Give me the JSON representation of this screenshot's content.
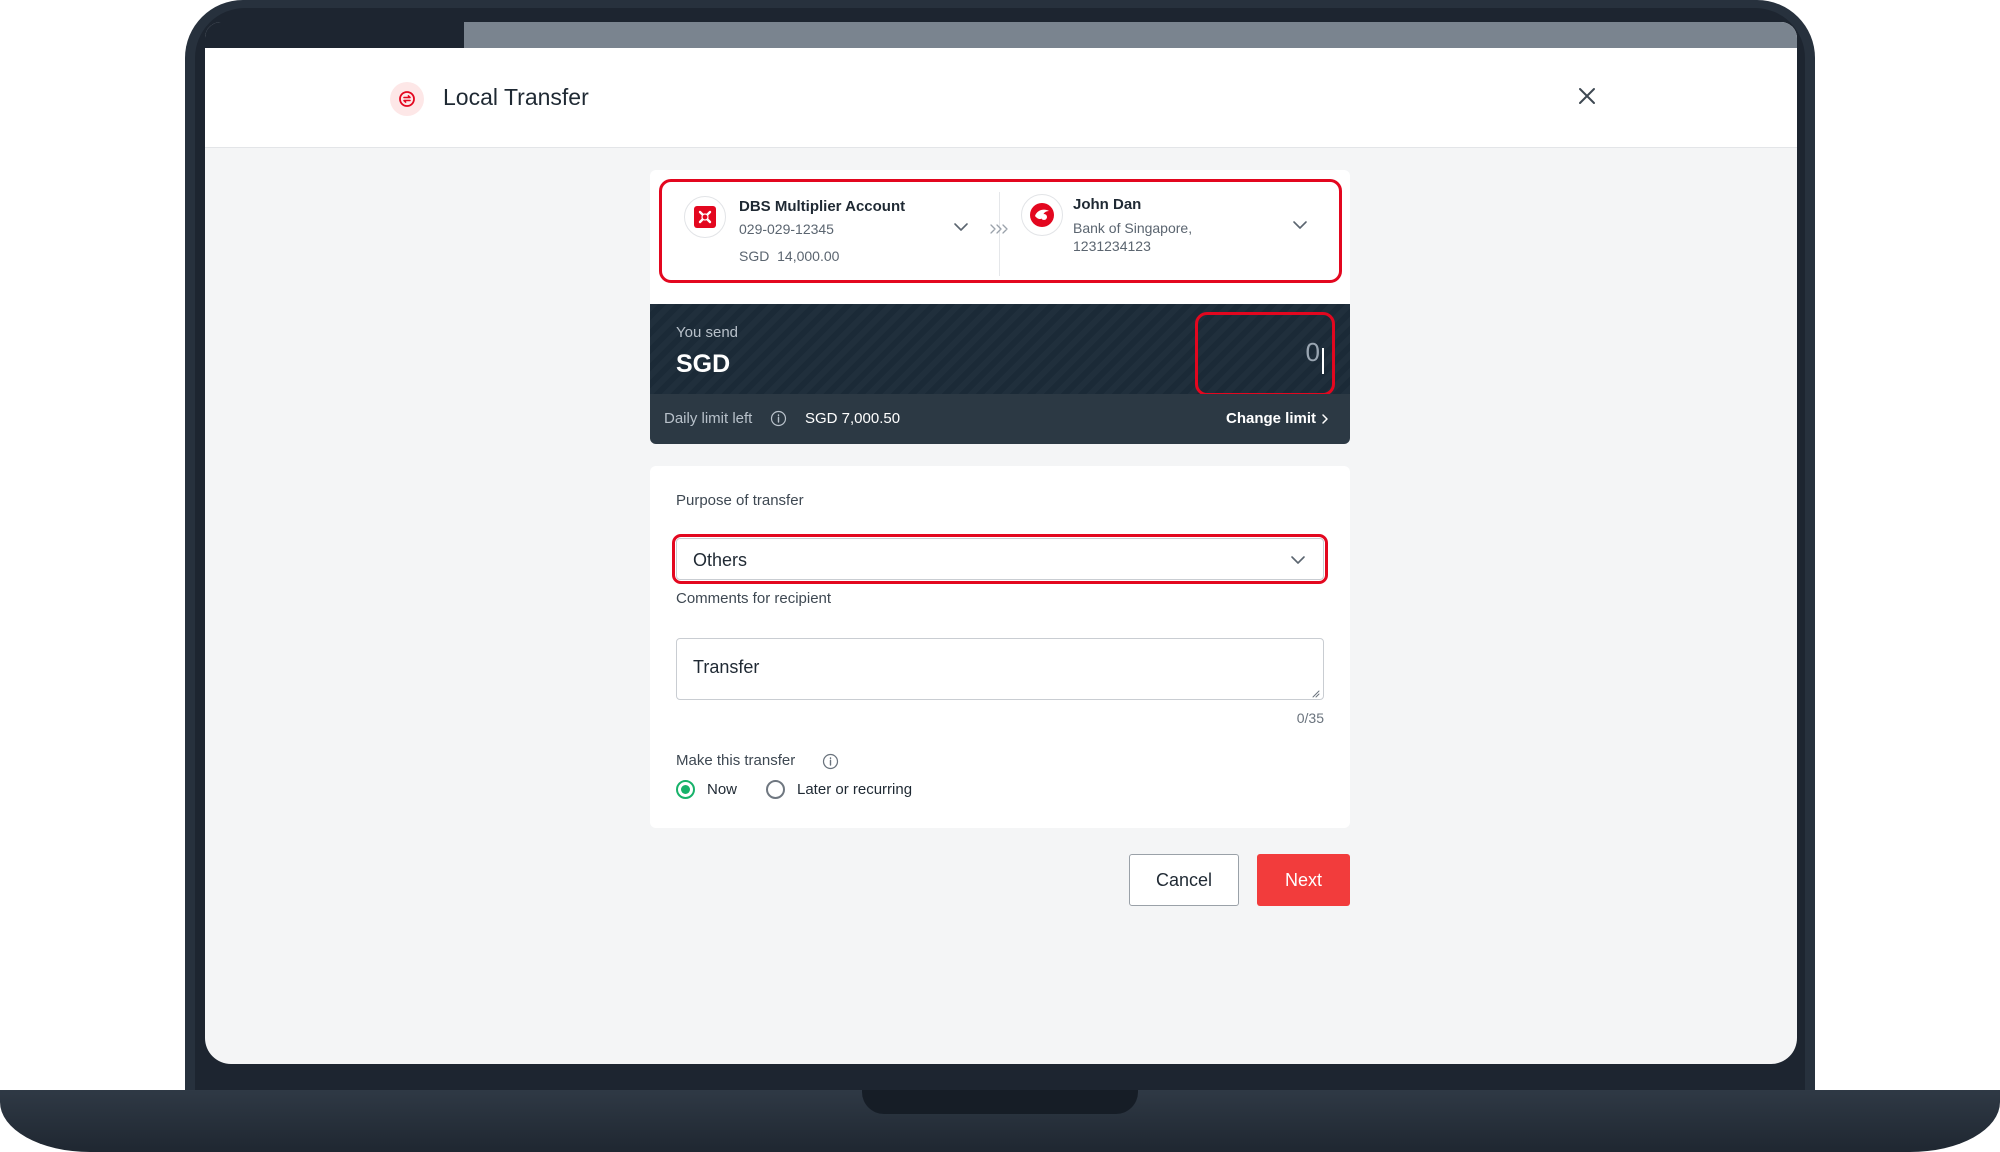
{
  "header": {
    "title": "Local Transfer"
  },
  "progress": {
    "fraction": 0.163
  },
  "from_account": {
    "name": "DBS Multiplier Account",
    "number": "029-029-12345",
    "balance": "SGD  14,000.00"
  },
  "to_account": {
    "name": "John Dan",
    "bank": "Bank of Singapore,",
    "number": "1231234123"
  },
  "send": {
    "label": "You send",
    "currency": "SGD",
    "amount": "0"
  },
  "limit": {
    "label": "Daily limit left",
    "value": "SGD 7,000.50",
    "change_label": "Change limit"
  },
  "form": {
    "purpose_label": "Purpose of transfer",
    "purpose_value": "Others",
    "comments_label": "Comments for recipient",
    "comments_value": "Transfer",
    "counter": "0/35",
    "timing_label": "Make this transfer",
    "timing_options": [
      {
        "label": "Now",
        "selected": true
      },
      {
        "label": "Later or recurring",
        "selected": false
      }
    ]
  },
  "buttons": {
    "cancel": "Cancel",
    "next": "Next"
  },
  "colors": {
    "highlight": "#e3071f",
    "primary_button": "#f23c3c",
    "radio_selected": "#17b26a",
    "send_panel": "#1b2a37"
  }
}
